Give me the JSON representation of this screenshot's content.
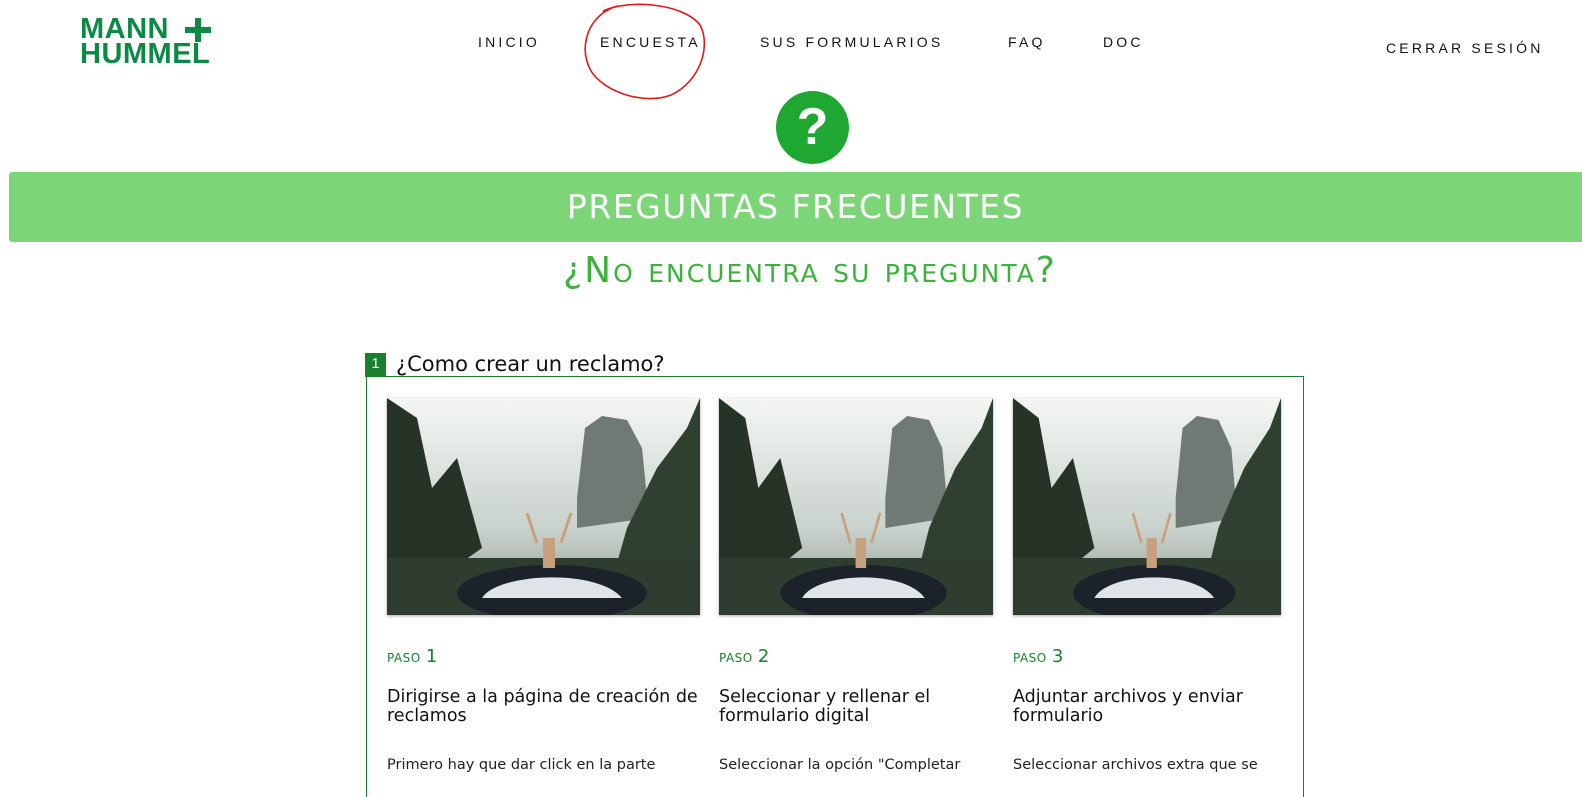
{
  "logo": {
    "line1": "MANN",
    "line2": "HUMMEL",
    "color": "#0b8a46"
  },
  "nav": {
    "items": [
      "INICIO",
      "ENCUESTA",
      "SUS FORMULARIOS",
      "FAQ",
      "DOC"
    ],
    "logout": "CERRAR SESIÓN"
  },
  "help_icon": "question-mark-icon",
  "banner": {
    "title": "PREGUNTAS FRECUENTES",
    "color": "#7cd577"
  },
  "subtitle": "¿No encuentra su pregunta?",
  "question": {
    "number": "1",
    "title": "¿Como crear un reclamo?",
    "steps": [
      {
        "paso": "paso",
        "num": "1",
        "title": "Dirigirse a la página de creación de reclamos",
        "desc": "Primero hay que dar click en la parte"
      },
      {
        "paso": "paso",
        "num": "2",
        "title": "Seleccionar y rellenar el formulario digital",
        "desc": "Seleccionar la opción \"Completar"
      },
      {
        "paso": "paso",
        "num": "3",
        "title": "Adjuntar archivos y enviar formulario",
        "desc": "Seleccionar archivos extra que se"
      }
    ]
  },
  "colors": {
    "accent_green": "#1ea832",
    "dark_green": "#1a7f2e",
    "annotation_red": "#e01818"
  }
}
